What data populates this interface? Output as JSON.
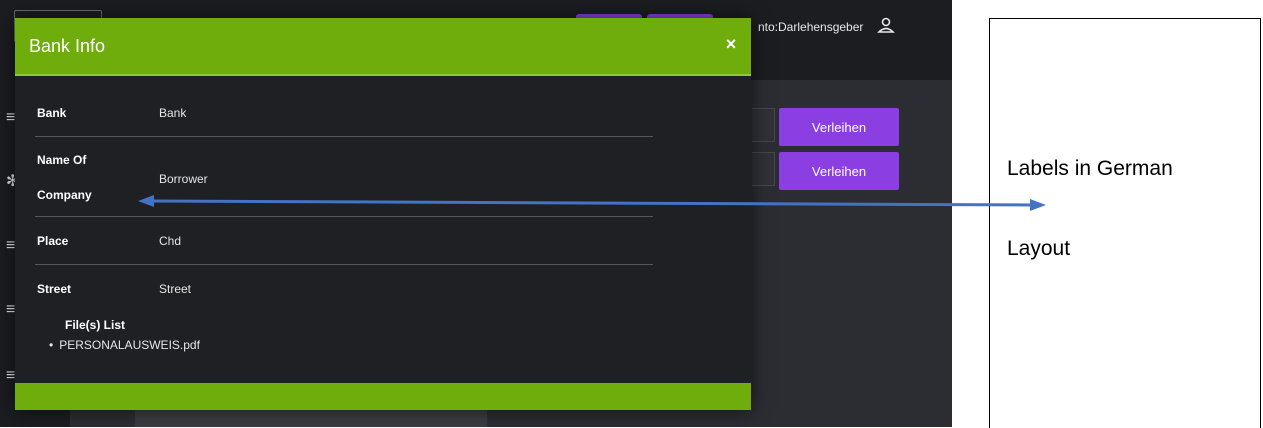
{
  "app": {
    "user_role": "nto:Darlehensgeber",
    "lend_buttons": [
      "Verleihen",
      "Verleihen"
    ]
  },
  "modal": {
    "title": "Bank Info",
    "close_glyph": "×",
    "fields": [
      {
        "label": "Bank",
        "value": "Bank"
      },
      {
        "label_line1": "Name Of",
        "label_line2": "Company",
        "value": "Borrower"
      },
      {
        "label": "Place",
        "value": "Chd"
      },
      {
        "label": "Street",
        "value": "Street"
      }
    ],
    "files_heading": "File(s) List",
    "files": [
      "PERSONALAUSWEIS.pdf"
    ]
  },
  "annotation": {
    "line1": "Labels in German",
    "line2": "Layout",
    "arrow_color": "#4472c4"
  },
  "colors": {
    "modal_green": "#6ead0b",
    "button_purple": "#8b3ee2",
    "dark_bg": "#26282d"
  },
  "icons": {
    "close": "close-icon",
    "user": "user-icon",
    "menu": "menu-icon",
    "settings": "gear-icon"
  }
}
